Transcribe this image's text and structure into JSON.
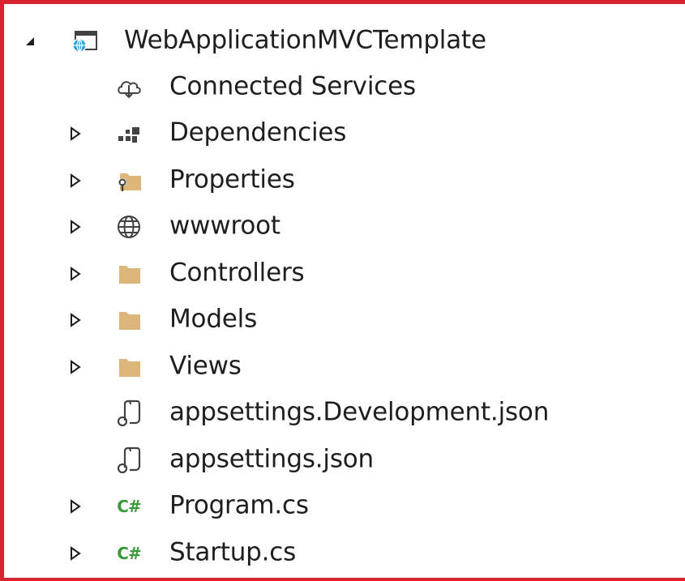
{
  "root": {
    "label": "WebApplicationMVCTemplate",
    "expanded": true,
    "icon": "web-project-icon"
  },
  "items": [
    {
      "label": "Connected Services",
      "icon": "connected-services-icon",
      "expandable": false
    },
    {
      "label": "Dependencies",
      "icon": "dependencies-icon",
      "expandable": true
    },
    {
      "label": "Properties",
      "icon": "properties-folder-icon",
      "expandable": true
    },
    {
      "label": "wwwroot",
      "icon": "globe-icon",
      "expandable": true
    },
    {
      "label": "Controllers",
      "icon": "folder-icon",
      "expandable": true
    },
    {
      "label": "Models",
      "icon": "folder-icon",
      "expandable": true
    },
    {
      "label": "Views",
      "icon": "folder-icon",
      "expandable": true
    },
    {
      "label": "appsettings.Development.json",
      "icon": "json-file-icon",
      "expandable": false
    },
    {
      "label": "appsettings.json",
      "icon": "json-file-icon",
      "expandable": false
    },
    {
      "label": "Program.cs",
      "icon": "csharp-file-icon",
      "expandable": true,
      "icon_text": "C#"
    },
    {
      "label": "Startup.cs",
      "icon": "csharp-file-icon",
      "expandable": true,
      "icon_text": "C#"
    }
  ],
  "colors": {
    "border": "#d9232e",
    "folder": "#dcb67a",
    "csharp": "#3a9a3a",
    "text": "#1e1e1e"
  }
}
